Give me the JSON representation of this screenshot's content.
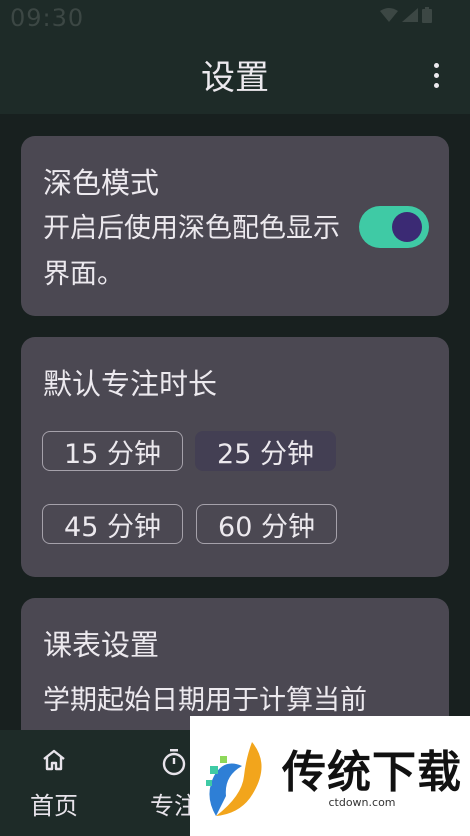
{
  "status_bar": {
    "time": "09:30"
  },
  "app_bar": {
    "title": "设置"
  },
  "dark_mode": {
    "title": "深色模式",
    "description": "开启后使用深色配色显示界面。",
    "enabled": true
  },
  "focus_duration": {
    "title": "默认专注时长",
    "options": [
      "15 分钟",
      "25 分钟",
      "45 分钟",
      "60 分钟"
    ],
    "selected": "25 分钟"
  },
  "schedule": {
    "title": "课表设置",
    "description": "学期起始日期用于计算当前"
  },
  "bottom_nav": {
    "items": [
      {
        "label": "首页",
        "icon": "home-icon"
      },
      {
        "label": "专注",
        "icon": "timer-icon"
      }
    ]
  },
  "ad": {
    "title": "传统下载",
    "url": "ctdown.com"
  },
  "colors": {
    "background": "#18201f",
    "surface": "#4b4852",
    "bar": "#1e2b28",
    "switch_track": "#3fcaa5",
    "switch_thumb": "#3b2a74",
    "chip_selected": "#433f53"
  }
}
